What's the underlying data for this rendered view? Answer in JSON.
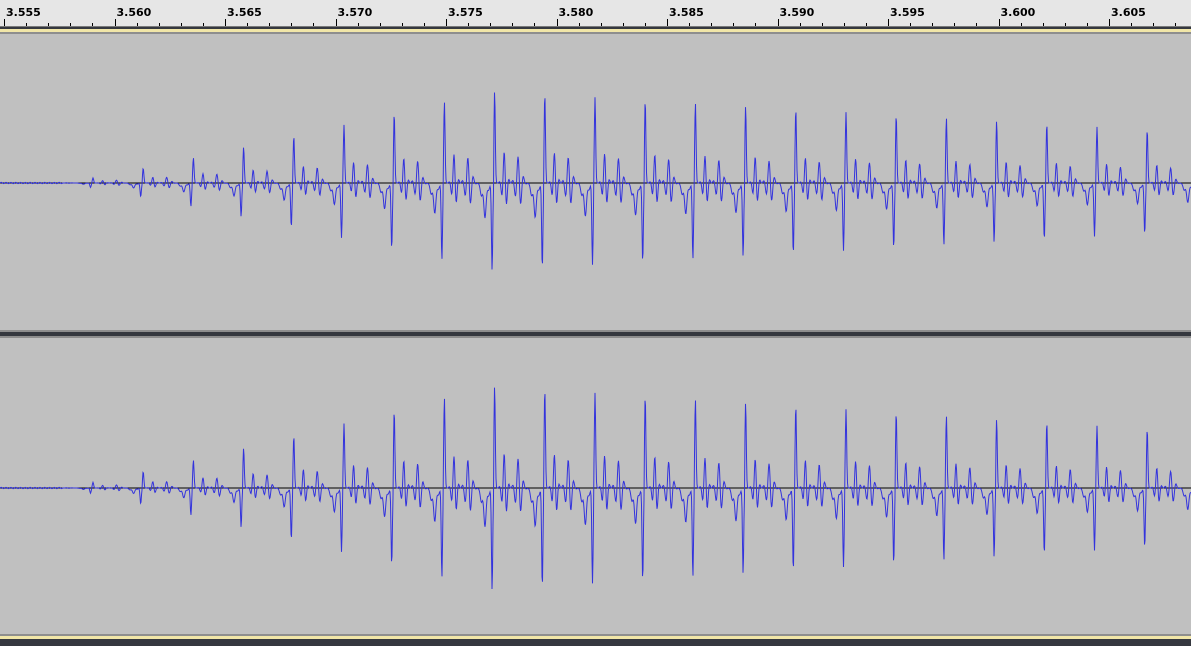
{
  "ruler": {
    "ticks": [
      "3.555",
      "3.560",
      "3.565",
      "3.570",
      "3.575",
      "3.580",
      "3.585",
      "3.590",
      "3.595",
      "3.600",
      "3.605"
    ]
  },
  "colors": {
    "background": "#c0c0c0",
    "waveform": "#3333dd",
    "zero_line": "#000000",
    "selection_edge": "#f1e6a8",
    "track_divider": "#35383f"
  },
  "tracks": [
    {
      "channel": "left"
    },
    {
      "channel": "right"
    }
  ]
}
